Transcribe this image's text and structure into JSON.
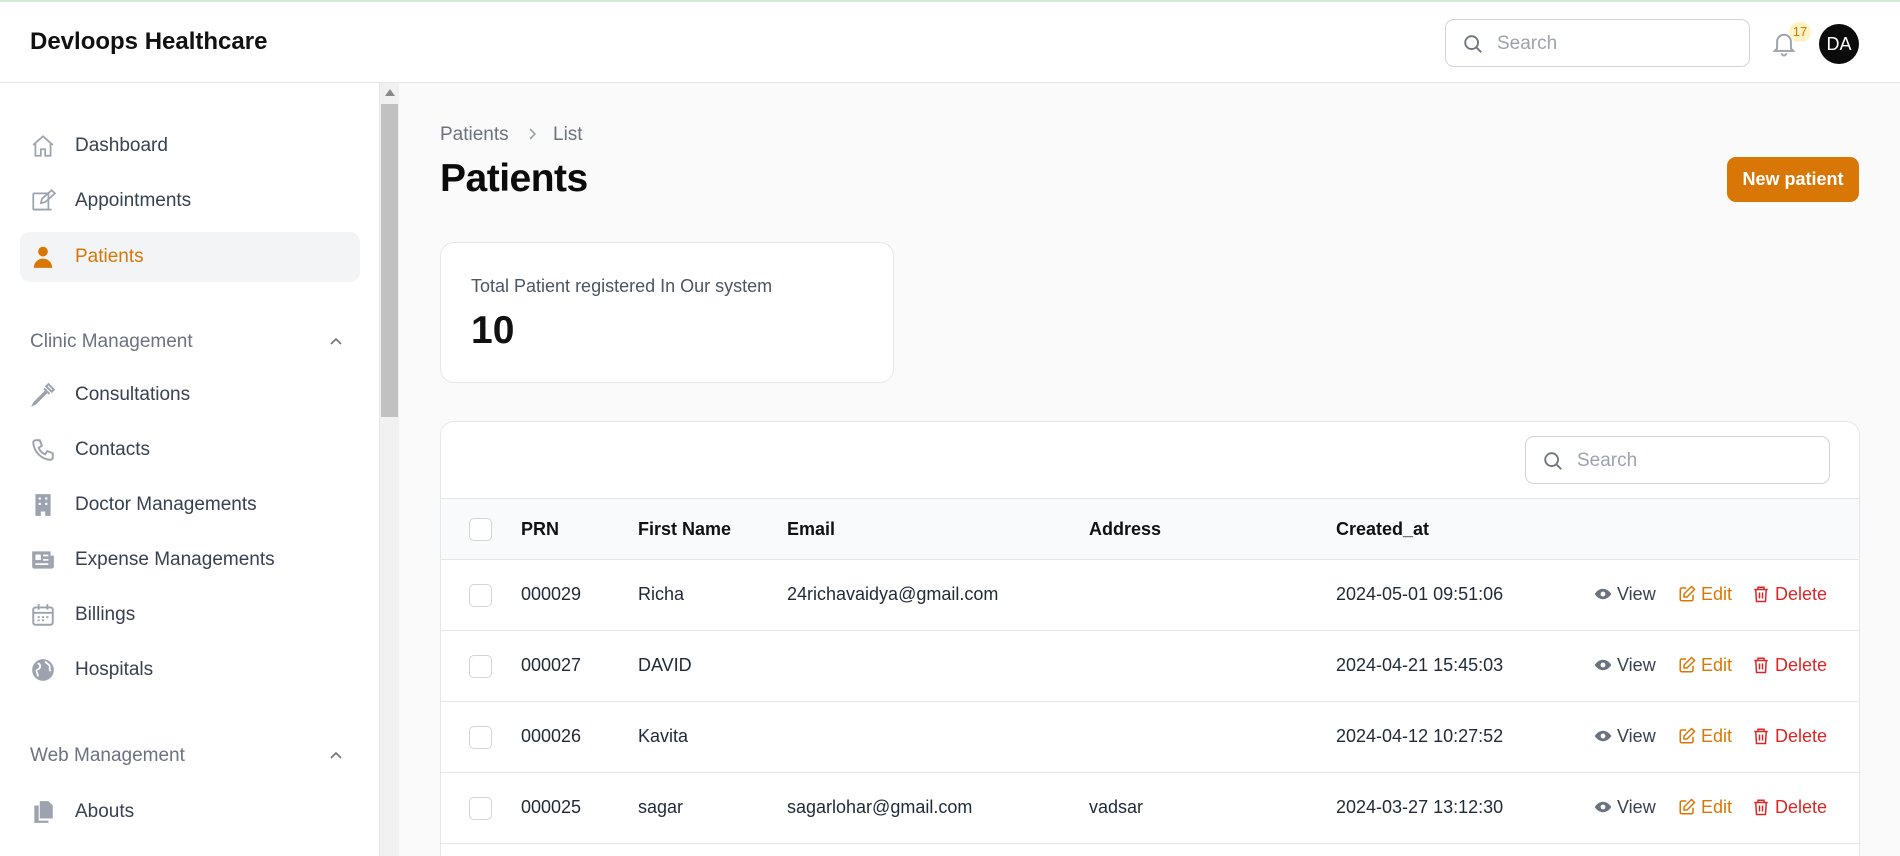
{
  "app": {
    "title": "Devloops Healthcare"
  },
  "topbar": {
    "search_placeholder": "Search",
    "notification_count": "17",
    "avatar_initials": "DA"
  },
  "sidebar": {
    "items": [
      {
        "label": "Dashboard",
        "icon": "home-icon"
      },
      {
        "label": "Appointments",
        "icon": "edit-icon"
      },
      {
        "label": "Patients",
        "icon": "user-icon",
        "active": true
      }
    ],
    "groups": [
      {
        "label": "Clinic Management",
        "items": [
          {
            "label": "Consultations",
            "icon": "eyedropper-icon"
          },
          {
            "label": "Contacts",
            "icon": "phone-icon"
          },
          {
            "label": "Doctor Managements",
            "icon": "building-icon"
          },
          {
            "label": "Expense Managements",
            "icon": "newspaper-icon"
          },
          {
            "label": "Billings",
            "icon": "calendar-icon"
          },
          {
            "label": "Hospitals",
            "icon": "globe-icon"
          }
        ]
      },
      {
        "label": "Web Management",
        "items": [
          {
            "label": "Abouts",
            "icon": "documents-icon"
          }
        ]
      }
    ]
  },
  "breadcrumb": {
    "items": [
      "Patients",
      "List"
    ]
  },
  "page": {
    "title": "Patients",
    "new_button_label": "New patient"
  },
  "stats": {
    "label": "Total Patient registered In Our system",
    "value": "10"
  },
  "table": {
    "search_placeholder": "Search",
    "columns": [
      "PRN",
      "First Name",
      "Email",
      "Address",
      "Created_at"
    ],
    "actions": {
      "view": "View",
      "edit": "Edit",
      "delete": "Delete"
    },
    "rows": [
      {
        "prn": "000029",
        "first_name": "Richa",
        "email": "24richavaidya@gmail.com",
        "address": "",
        "created_at": "2024-05-01 09:51:06"
      },
      {
        "prn": "000027",
        "first_name": "DAVID",
        "email": "",
        "address": "",
        "created_at": "2024-04-21 15:45:03"
      },
      {
        "prn": "000026",
        "first_name": "Kavita",
        "email": "",
        "address": "",
        "created_at": "2024-04-12 10:27:52"
      },
      {
        "prn": "000025",
        "first_name": "sagar",
        "email": "sagarlohar@gmail.com",
        "address": "vadsar",
        "created_at": "2024-03-27 13:12:30"
      }
    ]
  },
  "colors": {
    "accent": "#d97706",
    "danger": "#dc2626",
    "text": "#111827"
  }
}
